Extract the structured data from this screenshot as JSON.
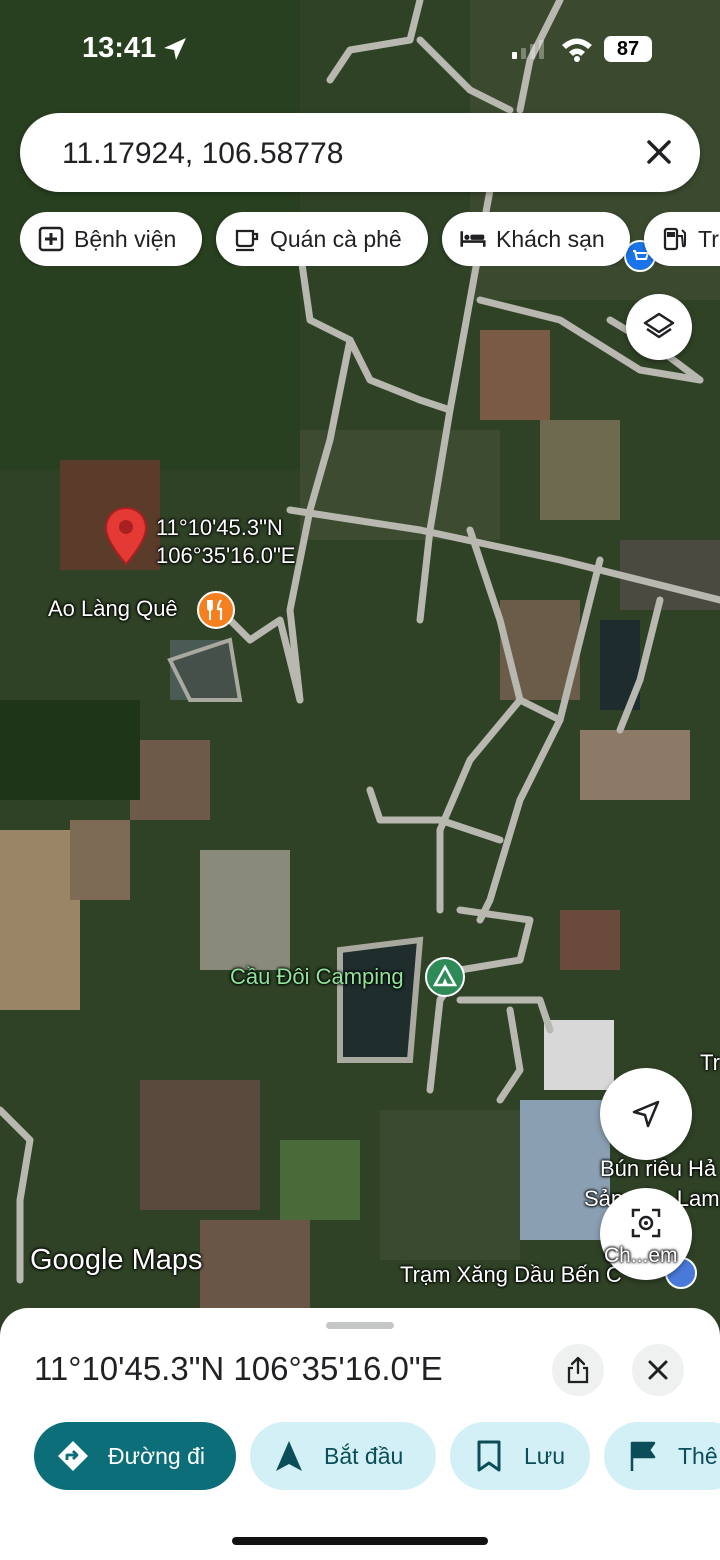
{
  "status_bar": {
    "time": "13:41",
    "battery": "87"
  },
  "search": {
    "query": "11.17924, 106.58778"
  },
  "chips": [
    "Bệnh viện",
    "Quán cà phê",
    "Khách sạn",
    "Tr"
  ],
  "map": {
    "pin_coords_line1": "11°10'45.3\"N",
    "pin_coords_line2": "106°35'16.0\"E",
    "places": {
      "ao_lang_que": "Ao Làng Quê",
      "cau_doi_camping": "Cầu Đôi Camping",
      "bun_rieu": "Bún riêu Hả",
      "san_lam": "Sản  ườn Lam",
      "tram_xang": "Trạm Xăng Dầu Bến C",
      "tr_edge": "Tr"
    },
    "watermark": "Google Maps",
    "lens_label": "Ch...em",
    "colors": {
      "pin": "#e53935",
      "restaurant": "#f4801f",
      "camping": "#2e8b57",
      "road": "#b8b8b0"
    }
  },
  "sheet": {
    "title": "11°10'45.3\"N 106°35'16.0\"E",
    "actions": [
      "Đường đi",
      "Bắt đầu",
      "Lưu",
      "Thê"
    ],
    "colors": {
      "primary": "#0b6e79",
      "secondary": "#d3f0f6"
    }
  }
}
